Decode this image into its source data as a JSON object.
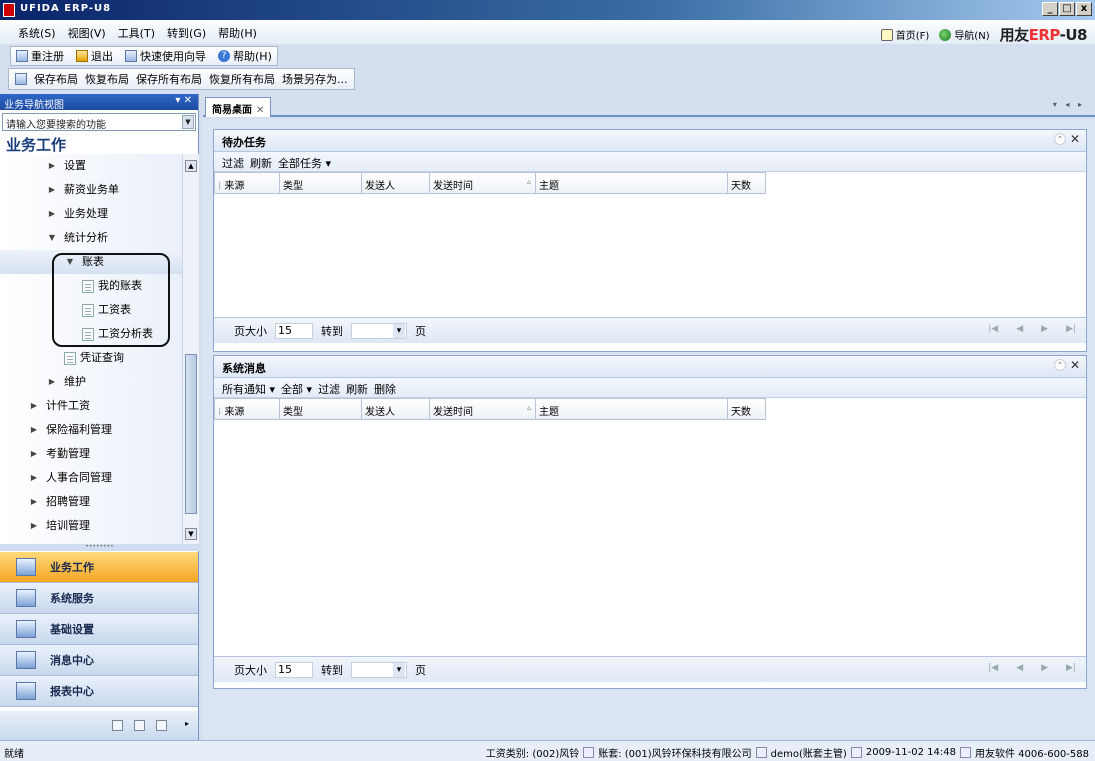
{
  "window": {
    "title": "UFIDA ERP-U8"
  },
  "window_buttons": [
    "_",
    "□",
    "x"
  ],
  "menubar": {
    "items": [
      "系统(S)",
      "视图(V)",
      "工具(T)",
      "转到(G)",
      "帮助(H)"
    ]
  },
  "top_links": {
    "home": "首页(F)",
    "nav": "导航(N)",
    "brand_prefix": "用友",
    "brand_erp": "ERP",
    "brand_suffix": "-U8"
  },
  "toolbar1": {
    "relogin": "重注册",
    "exit": "退出",
    "quick_wizard": "快速使用向导",
    "help": "帮助(H)"
  },
  "toolbar2": {
    "items": [
      "保存布局",
      "恢复布局",
      "保存所有布局",
      "恢复所有布局",
      "场景另存为..."
    ]
  },
  "nav_panel": {
    "header": "业务导航视图",
    "pin": "▾ ✕",
    "search_placeholder": "请输入您要搜索的功能",
    "title": "业务工作",
    "tree": [
      {
        "label": "设置",
        "indent": 1,
        "type": "collapsed"
      },
      {
        "label": "薪资业务单",
        "indent": 1,
        "type": "collapsed"
      },
      {
        "label": "业务处理",
        "indent": 1,
        "type": "collapsed"
      },
      {
        "label": "统计分析",
        "indent": 1,
        "type": "expanded"
      },
      {
        "label": "账表",
        "indent": 2,
        "type": "expanded",
        "selected": true
      },
      {
        "label": "我的账表",
        "indent": 3,
        "type": "leaf"
      },
      {
        "label": "工资表",
        "indent": 3,
        "type": "leaf"
      },
      {
        "label": "工资分析表",
        "indent": 3,
        "type": "leaf"
      },
      {
        "label": "凭证查询",
        "indent": 2,
        "type": "leaf"
      },
      {
        "label": "维护",
        "indent": 1,
        "type": "collapsed"
      },
      {
        "label": "计件工资",
        "indent": 0,
        "type": "collapsed"
      },
      {
        "label": "保险福利管理",
        "indent": 0,
        "type": "collapsed"
      },
      {
        "label": "考勤管理",
        "indent": 0,
        "type": "collapsed"
      },
      {
        "label": "人事合同管理",
        "indent": 0,
        "type": "collapsed"
      },
      {
        "label": "招聘管理",
        "indent": 0,
        "type": "collapsed"
      },
      {
        "label": "培训管理",
        "indent": 0,
        "type": "collapsed"
      }
    ],
    "modules": [
      {
        "label": "业务工作",
        "active": true
      },
      {
        "label": "系统服务",
        "active": false
      },
      {
        "label": "基础设置",
        "active": false
      },
      {
        "label": "消息中心",
        "active": false
      },
      {
        "label": "报表中心",
        "active": false
      }
    ]
  },
  "tab": {
    "label": "简易桌面",
    "close": "✕",
    "nav": "▾ ◂ ▸"
  },
  "todo_panel": {
    "title": "待办任务",
    "tools": [
      "过滤",
      "刷新",
      "全部任务 ▾"
    ],
    "columns": [
      "来源",
      "类型",
      "发送人",
      "发送时间",
      "主题",
      "天数"
    ],
    "pager": {
      "page_size_label": "页大小",
      "page_size": "15",
      "goto_label": "转到",
      "page_label": "页"
    }
  },
  "msg_panel": {
    "title": "系统消息",
    "tools": [
      "所有通知 ▾",
      "全部 ▾",
      "过滤",
      "刷新",
      "删除"
    ],
    "columns": [
      "来源",
      "类型",
      "发送人",
      "发送时间",
      "主题",
      "天数"
    ],
    "pager": {
      "page_size_label": "页大小",
      "page_size": "15",
      "goto_label": "转到",
      "page_label": "页"
    }
  },
  "statusbar": {
    "left": "就绪",
    "salary_type": "工资类别: (002)风铃",
    "account": "账套: (001)风铃环保科技有限公司",
    "user": "demo(账套主管)",
    "datetime": "2009-11-02 14:48",
    "hotline": "用友软件 4006-600-588"
  }
}
